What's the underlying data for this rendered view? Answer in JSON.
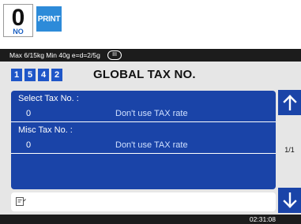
{
  "keys": {
    "zero": {
      "main": "0",
      "sub": "NO"
    },
    "print": {
      "label": "PRINT"
    }
  },
  "status": {
    "text": "Max 6/15kg Min 40g e=d=2/5g",
    "range": "III"
  },
  "header": {
    "codes": [
      "1",
      "5",
      "4",
      "2"
    ],
    "title": "GLOBAL TAX NO."
  },
  "fields": [
    {
      "label": "Select Tax No. :",
      "value": "0",
      "desc": "Don't use TAX rate"
    },
    {
      "label": "Misc Tax No. :",
      "value": "0",
      "desc": "Don't use TAX rate"
    }
  ],
  "pager": {
    "indicator": "1/1"
  },
  "input": {
    "icon": "edit-note-icon",
    "value": ""
  },
  "clock": "02:31:08",
  "colors": {
    "panel": "#1a44a8",
    "code_box": "#1f56c8",
    "print_key": "#2d8bd9",
    "status_bar": "#1c1c1c"
  }
}
